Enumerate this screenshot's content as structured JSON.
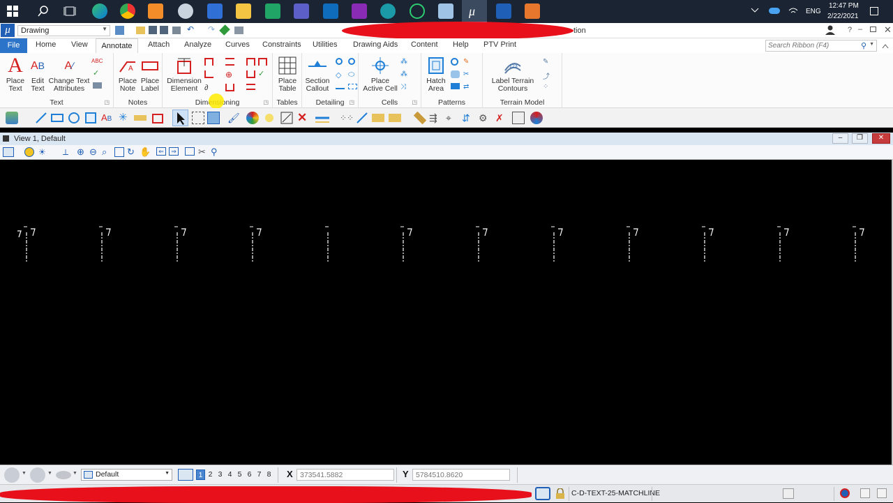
{
  "taskbar": {
    "lang": "ENG",
    "time": "12:47 PM",
    "date": "2/22/2021"
  },
  "titlebar": {
    "model_name": "Drawing",
    "title_tail": "tion",
    "search_placeholder": "Search Ribbon (F4)"
  },
  "ribbon_tabs": [
    "File",
    "Home",
    "View",
    "Annotate",
    "Attach",
    "Analyze",
    "Curves",
    "Constraints",
    "Utilities",
    "Drawing Aids",
    "Content",
    "Help",
    "PTV Print"
  ],
  "ribbon": {
    "text_group": {
      "label": "Text",
      "place_text": "Place Text",
      "edit_text": "Edit Text",
      "change_text_attributes": "Change Text Attributes"
    },
    "notes_group": {
      "label": "Notes",
      "place_note": "Place Note",
      "place_label": "Place Label"
    },
    "dimensioning_group": {
      "label": "Dimensioning",
      "dimension_element": "Dimension Element"
    },
    "tables_group": {
      "label": "Tables",
      "place_table": "Place Table"
    },
    "detailing_group": {
      "label": "Detailing",
      "section_callout": "Section Callout"
    },
    "cells_group": {
      "label": "Cells",
      "place_active_cell": "Place Active Cell"
    },
    "patterns_group": {
      "label": "Patterns",
      "hatch_area": "Hatch Area"
    },
    "terrain_group": {
      "label": "Terrain Model",
      "label_terrain_contours": "Label Terrain Contours"
    }
  },
  "view": {
    "title": "View 1, Default"
  },
  "status": {
    "view_group": "Default",
    "view_numbers": [
      "1",
      "2",
      "3",
      "4",
      "5",
      "6",
      "7",
      "8"
    ],
    "x_label": "X",
    "x_value": "373541.5882",
    "y_label": "Y",
    "y_value": "5784510.8620",
    "level": "C-D-TEXT-25-MATCHLINE"
  },
  "colors": {
    "accent": "#1f5fb5",
    "file_tab": "#2b74c9",
    "canvas": "#000000",
    "redaction": "#e8101a"
  }
}
